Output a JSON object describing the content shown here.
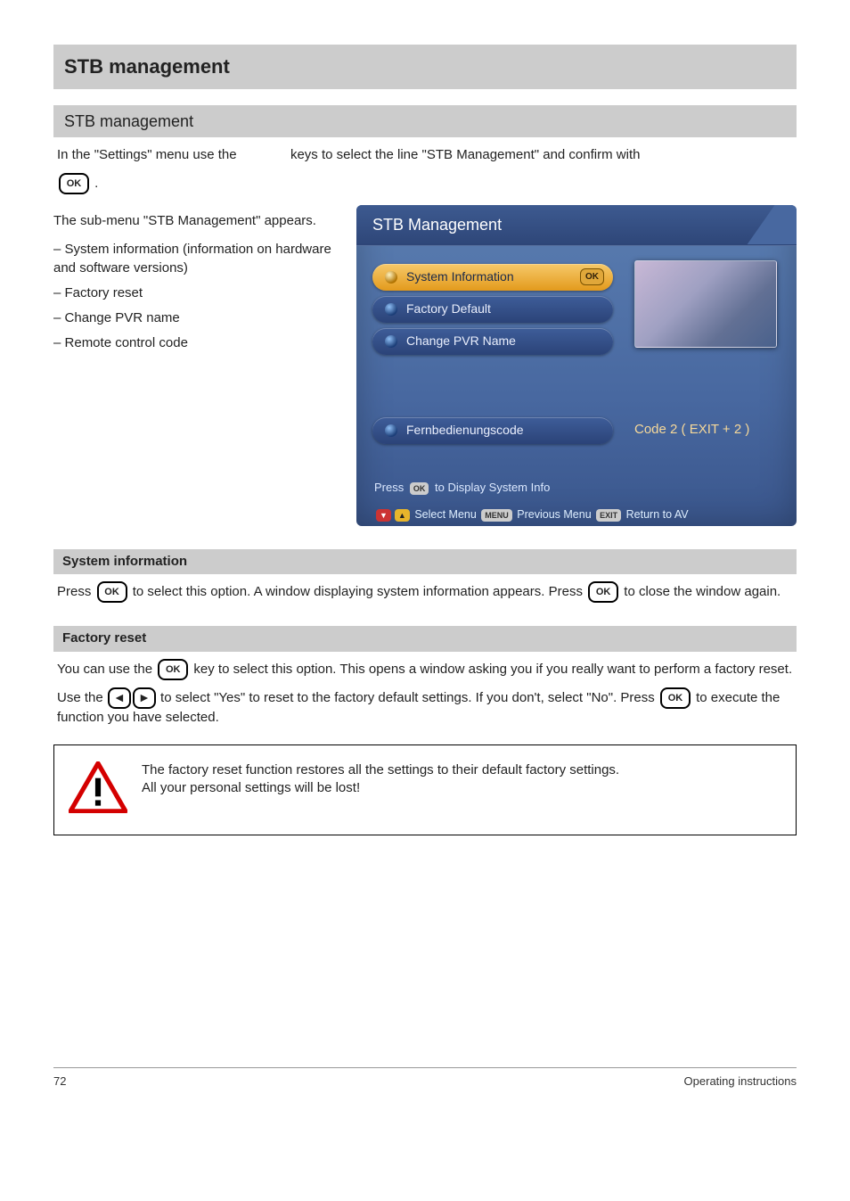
{
  "header": {
    "title": "STB management"
  },
  "subheader": {
    "title": "STB management"
  },
  "intro": {
    "line1_a": "In the \"Settings\" menu use the ",
    "line1_b": " keys to select the line \"STB Management\" and confirm with",
    "line2": "."
  },
  "ok_label": "OK",
  "sub_list_intro": "The sub-menu \"STB Management\" appears.",
  "sub_items": [
    "System information (information on hardware and software versions)",
    "Factory reset",
    "Change PVR name",
    "Remote control code"
  ],
  "screenshot": {
    "title": "STB Management",
    "items": [
      {
        "label": "System Information",
        "selected": true,
        "ok": true
      },
      {
        "label": "Factory Default",
        "selected": false
      },
      {
        "label": "Change PVR Name",
        "selected": false
      }
    ],
    "rc_label": "Fernbedienungscode",
    "rc_value": "Code 2 ( EXIT + 2 )",
    "hint_a": "Press",
    "hint_ok": "OK",
    "hint_b": "to Display System Info",
    "footer_select": "Select Menu",
    "footer_menu_key": "MENU",
    "footer_prev": "Previous Menu",
    "footer_exit_key": "EXIT",
    "footer_return": "Return to AV"
  },
  "sec_sysinfo": {
    "head": "System information",
    "body_a": "Press ",
    "body_b": " to select this option. A window displaying system information appears. Press ",
    "body_c": " to close the window again."
  },
  "sec_factory": {
    "head": "Factory reset",
    "line1_a": "You can use the ",
    "line1_b": " key to select this option. This opens a window asking you if you really want to perform a factory reset.",
    "line2_a": "Use the ",
    "line2_b": " to select \"Yes\" to reset to the factory default settings. If you don't, select \"No\". Press ",
    "line2_c": " to execute the function you have selected."
  },
  "warn": {
    "line1": "The factory reset function restores all the settings to their default factory settings.",
    "line2": "All your personal settings will be lost!"
  },
  "footer": {
    "left": "72",
    "right": "Operating instructions"
  },
  "arrow_left": "◄",
  "arrow_right": "►"
}
